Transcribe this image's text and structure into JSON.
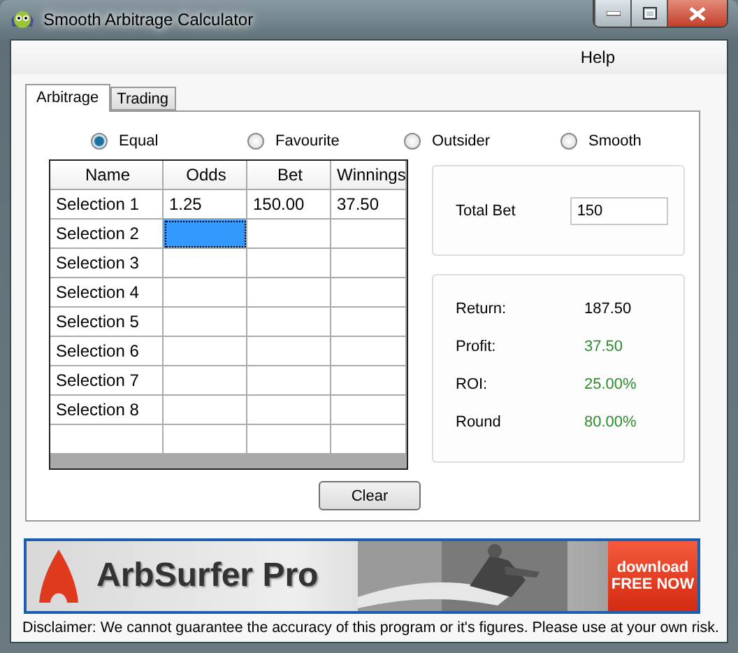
{
  "window": {
    "title": "Smooth Arbitrage Calculator"
  },
  "menu": [
    "Help"
  ],
  "tabs": [
    {
      "label": "Arbitrage",
      "selected": true
    },
    {
      "label": "Trading",
      "selected": false
    }
  ],
  "modes": [
    {
      "label": "Equal",
      "selected": true
    },
    {
      "label": "Favourite",
      "selected": false
    },
    {
      "label": "Outsider",
      "selected": false
    },
    {
      "label": "Smooth",
      "selected": false
    }
  ],
  "table": {
    "columns": [
      "Name",
      "Odds",
      "Bet",
      "Winnings"
    ],
    "rows": [
      {
        "cells": [
          {
            "text": "Selection 1",
            "selected": false
          },
          {
            "text": "1.25",
            "selected": false
          },
          {
            "text": "150.00",
            "selected": false
          },
          {
            "text": "37.50",
            "selected": false
          }
        ]
      },
      {
        "cells": [
          {
            "text": "Selection 2",
            "selected": false
          },
          {
            "selected": true
          },
          {
            "selected": false
          },
          {
            "selected": false
          }
        ]
      },
      {
        "cells": [
          {
            "text": "Selection 3",
            "selected": false
          },
          {
            "selected": false
          },
          {
            "selected": false
          },
          {
            "selected": false
          }
        ]
      },
      {
        "cells": [
          {
            "text": "Selection 4",
            "selected": false
          },
          {
            "selected": false
          },
          {
            "selected": false
          },
          {
            "selected": false
          }
        ]
      },
      {
        "cells": [
          {
            "text": "Selection 5",
            "selected": false
          },
          {
            "selected": false
          },
          {
            "selected": false
          },
          {
            "selected": false
          }
        ]
      },
      {
        "cells": [
          {
            "text": "Selection 6",
            "selected": false
          },
          {
            "selected": false
          },
          {
            "selected": false
          },
          {
            "selected": false
          }
        ]
      },
      {
        "cells": [
          {
            "text": "Selection 7",
            "selected": false
          },
          {
            "selected": false
          },
          {
            "selected": false
          },
          {
            "selected": false
          }
        ]
      },
      {
        "cells": [
          {
            "text": "Selection 8",
            "selected": false
          },
          {
            "selected": false
          },
          {
            "selected": false
          },
          {
            "selected": false
          }
        ]
      }
    ]
  },
  "clear_button": "Clear",
  "total_bet": {
    "label": "Total Bet",
    "value": "150"
  },
  "results": [
    {
      "label": "Return:",
      "value": "187.50",
      "color": "#000000"
    },
    {
      "label": "Profit:",
      "value": "37.50",
      "color": "#2e8b2e"
    },
    {
      "label": "ROI:",
      "value": "25.00%",
      "color": "#2e8b2e"
    },
    {
      "label": "Round",
      "value": "80.00%",
      "color": "#2e8b2e"
    }
  ],
  "banner": {
    "title": "ArbSurfer Pro",
    "cta_line_1": "download",
    "cta_line_2": "FREE NOW"
  },
  "disclaimer": "Disclaimer: We cannot guarantee the accuracy of this program or it's figures. Please use at your own risk."
}
